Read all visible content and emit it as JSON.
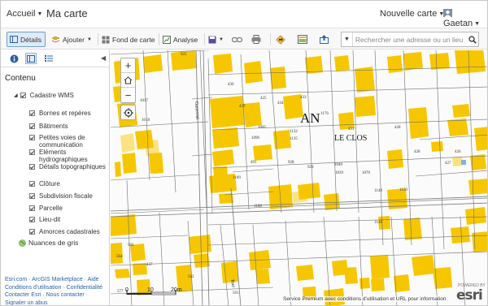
{
  "header": {
    "home_label": "Accueil",
    "map_title": "Ma carte",
    "new_map_label": "Nouvelle carte",
    "user_label": "Gaetan"
  },
  "toolbar": {
    "details_label": "Détails",
    "add_label": "Ajouter",
    "basemap_label": "Fond de carte",
    "analysis_label": "Analyse",
    "search_placeholder": "Rechercher une adresse ou un lieu"
  },
  "sidebar": {
    "contents_title": "Contenu",
    "group_layer": "Cadastre WMS",
    "layers": [
      "Bornes et repères",
      "Bâtiments",
      "Petites voies de communication",
      "Eléments hydrographiques",
      "Détails topographiques",
      "Clôture",
      "Subdivision fiscale",
      "Parcelle",
      "Lieu-dit",
      "Amorces cadastrales"
    ],
    "basemap_label": "Nuances de gris",
    "links": [
      "Esri.com",
      "ArcGIS Marketplace",
      "Aide",
      "Conditions d'utilisation",
      "Confidentialité",
      "Contacter Esri",
      "Nous contacter",
      "Signaler un abus"
    ]
  },
  "map": {
    "section_label": "AN",
    "lieu_dit_label": "LE CLOS",
    "street_label_1": "Genevrai",
    "street_label_2": "Rue",
    "attribution": "Service Premium avec conditions d'utilisation et URL pour information",
    "logo_text": "esri",
    "logo_powered": "POWERED BY",
    "scale_labels": [
      "0",
      "10",
      "20m"
    ],
    "parcel_numbers": [
      "925",
      "1017",
      "436",
      "437",
      "425",
      "434",
      "433",
      "1018",
      "1095",
      "1132",
      "1135",
      "431",
      "428",
      "1096",
      "1176",
      "428",
      "426",
      "427",
      "491",
      "929",
      "928",
      "1040",
      "1039",
      "1070",
      "1109",
      "1149",
      "1108",
      "1150",
      "1149",
      "504",
      "437",
      "564",
      "577",
      "562",
      "561"
    ]
  },
  "colors": {
    "building": "#f6c700",
    "building_light": "#fbe283",
    "parcel_line": "#6f6f6f",
    "accent": "#2a5fa8"
  }
}
